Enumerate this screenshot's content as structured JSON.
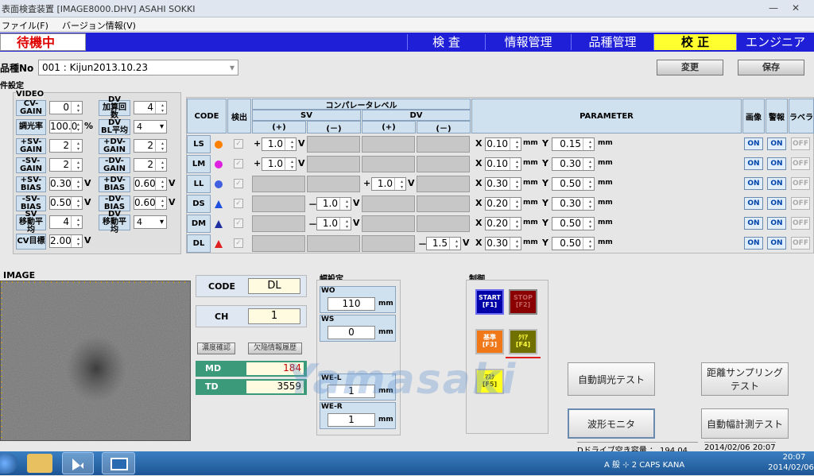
{
  "window": {
    "title": "表面検査装置 [IMAGE8000.DHV] ASAHI SOKKI",
    "minimize": "—",
    "close": "✕"
  },
  "menu": {
    "file": "ファイル(F)",
    "version": "バージョン情報(V)"
  },
  "status": "待機中",
  "nav": {
    "tabs": [
      "検 査",
      "情報管理",
      "品種管理",
      "校 正",
      "エンジニア"
    ],
    "active": 3
  },
  "product": {
    "label": "品種No",
    "value": "001 : Kijun2013.10.23",
    "change_btn": "変更",
    "save_btn": "保存"
  },
  "conditions_label": "件設定",
  "video": {
    "label": "VIDEO",
    "rows": [
      {
        "l1": "CV-\nGAIN",
        "v1": "0",
        "u1": "",
        "l2": "DV\n加算回数",
        "v2": "4",
        "u2": "",
        "t2": "spin"
      },
      {
        "l1": "調光率",
        "v1": "100.0",
        "u1": "%",
        "l2": "DV\nBL平均",
        "v2": "4",
        "u2": "",
        "t2": "ddl"
      },
      {
        "l1": "+SV-\nGAIN",
        "v1": "2",
        "u1": "",
        "l2": "+DV-\nGAIN",
        "v2": "2",
        "u2": "",
        "t2": "spin"
      },
      {
        "l1": "-SV-\nGAIN",
        "v1": "2",
        "u1": "",
        "l2": "-DV-\nGAIN",
        "v2": "2",
        "u2": "",
        "t2": "spin"
      },
      {
        "l1": "+SV-\nBIAS",
        "v1": "0.30",
        "u1": "V",
        "l2": "+DV-\nBIAS",
        "v2": "0.60",
        "u2": "V",
        "t2": "spin"
      },
      {
        "l1": "-SV-\nBIAS",
        "v1": "0.50",
        "u1": "V",
        "l2": "-DV-\nBIAS",
        "v2": "0.60",
        "u2": "V",
        "t2": "spin"
      },
      {
        "l1": "SV\n移動平均",
        "v1": "4",
        "u1": "",
        "l2": "DV\n移動平均",
        "v2": "4",
        "u2": "",
        "t2": "ddl"
      },
      {
        "l1": "CV目標",
        "v1": "2.00",
        "u1": "V",
        "l2": "",
        "v2": "",
        "u2": "",
        "t2": ""
      }
    ]
  },
  "table": {
    "headers": {
      "code": "CODE",
      "detect": "検出",
      "comparator": "コンパレータレベル",
      "sv": "SV",
      "dv": "DV",
      "plus": "(+)",
      "minus": "(－)",
      "parameter": "PARAMETER",
      "image": "画像",
      "alarm": "警報",
      "label": "ラベラ"
    },
    "rows": [
      {
        "code": "LS",
        "color": "#ff7f00",
        "shape": "circle",
        "sv_plus": "1.0",
        "sv_minus": "",
        "dv_plus": "",
        "dv_minus": "",
        "x": "0.10",
        "y": "0.15"
      },
      {
        "code": "LM",
        "color": "#e020e0",
        "shape": "circle",
        "sv_plus": "1.0",
        "sv_minus": "",
        "dv_plus": "",
        "dv_minus": "",
        "x": "0.10",
        "y": "0.30"
      },
      {
        "code": "LL",
        "color": "#4060e0",
        "shape": "circle",
        "sv_plus": "",
        "sv_minus": "",
        "dv_plus": "1.0",
        "dv_minus": "",
        "x": "0.30",
        "y": "0.50"
      },
      {
        "code": "DS",
        "color": "#2050e0",
        "shape": "triangle",
        "sv_plus": "",
        "sv_minus": "1.0",
        "dv_plus": "",
        "dv_minus": "",
        "x": "0.20",
        "y": "0.30"
      },
      {
        "code": "DM",
        "color": "#2030a0",
        "shape": "triangle",
        "sv_plus": "",
        "sv_minus": "1.0",
        "dv_plus": "",
        "dv_minus": "",
        "x": "0.20",
        "y": "0.50"
      },
      {
        "code": "DL",
        "color": "#e02020",
        "shape": "triangle",
        "sv_plus": "",
        "sv_minus": "",
        "dv_plus": "",
        "dv_minus": "1.5",
        "x": "0.30",
        "y": "0.50"
      }
    ],
    "x_label": "X",
    "y_label": "Y",
    "mm": "mm",
    "v": "V",
    "plus_sign": "+",
    "minus_sign": "－",
    "on": "ON",
    "off": "OFF"
  },
  "image_panel": {
    "label": "IMAGE"
  },
  "info": {
    "code_label": "CODE",
    "code_value": "DL",
    "ch_label": "CH",
    "ch_value": "1",
    "density_btn": "濃度確認",
    "history_btn": "欠陥情報履歴",
    "md_label": "MD",
    "md_value": "184",
    "td_label": "TD",
    "td_value": "3559"
  },
  "width": {
    "label": "幅設定",
    "wo_label": "WO",
    "wo_value": "110",
    "ws_label": "WS",
    "ws_value": "0",
    "wel_label": "WE-L",
    "wel_value": "1",
    "wer_label": "WE-R",
    "wer_value": "1",
    "mm": "mm"
  },
  "control": {
    "label": "制御",
    "start": "START\n[F1]",
    "stop": "STOP\n[F2]",
    "kijun": "基準\n[F3]",
    "clear": "ｸﾘｱ\n[F4]",
    "mask": "ﾏｽｸ\n[F5]"
  },
  "buttons": {
    "auto_light": "自動調光テスト",
    "distance": "距離サンプリング\nテスト",
    "waveform": "波形モニタ",
    "auto_width": "自動幅計測テスト"
  },
  "watermark": "Yamasaki",
  "footer": {
    "disk": "Dドライブ空き容量 ： 194.04 GB",
    "datetime": "2014/02/06 20:07"
  },
  "taskbar": {
    "time": "20:07",
    "date": "2014/02/06",
    "tray": "A 般 ⊹ 2 CAPS KANA"
  }
}
